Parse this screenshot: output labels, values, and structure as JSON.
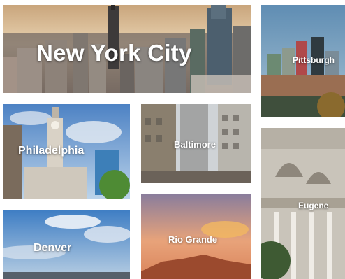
{
  "tiles": {
    "new_york": {
      "label": "New York City"
    },
    "pittsburgh": {
      "label": "Pittsburgh"
    },
    "philadelphia": {
      "label": "Philadelphia"
    },
    "baltimore": {
      "label": "Baltimore"
    },
    "eugene": {
      "label": "Eugene"
    },
    "rio_grande": {
      "label": "Rio Grande"
    },
    "denver": {
      "label": "Denver"
    }
  },
  "colors": {
    "label_text": "#ffffff",
    "background": "#ffffff"
  }
}
